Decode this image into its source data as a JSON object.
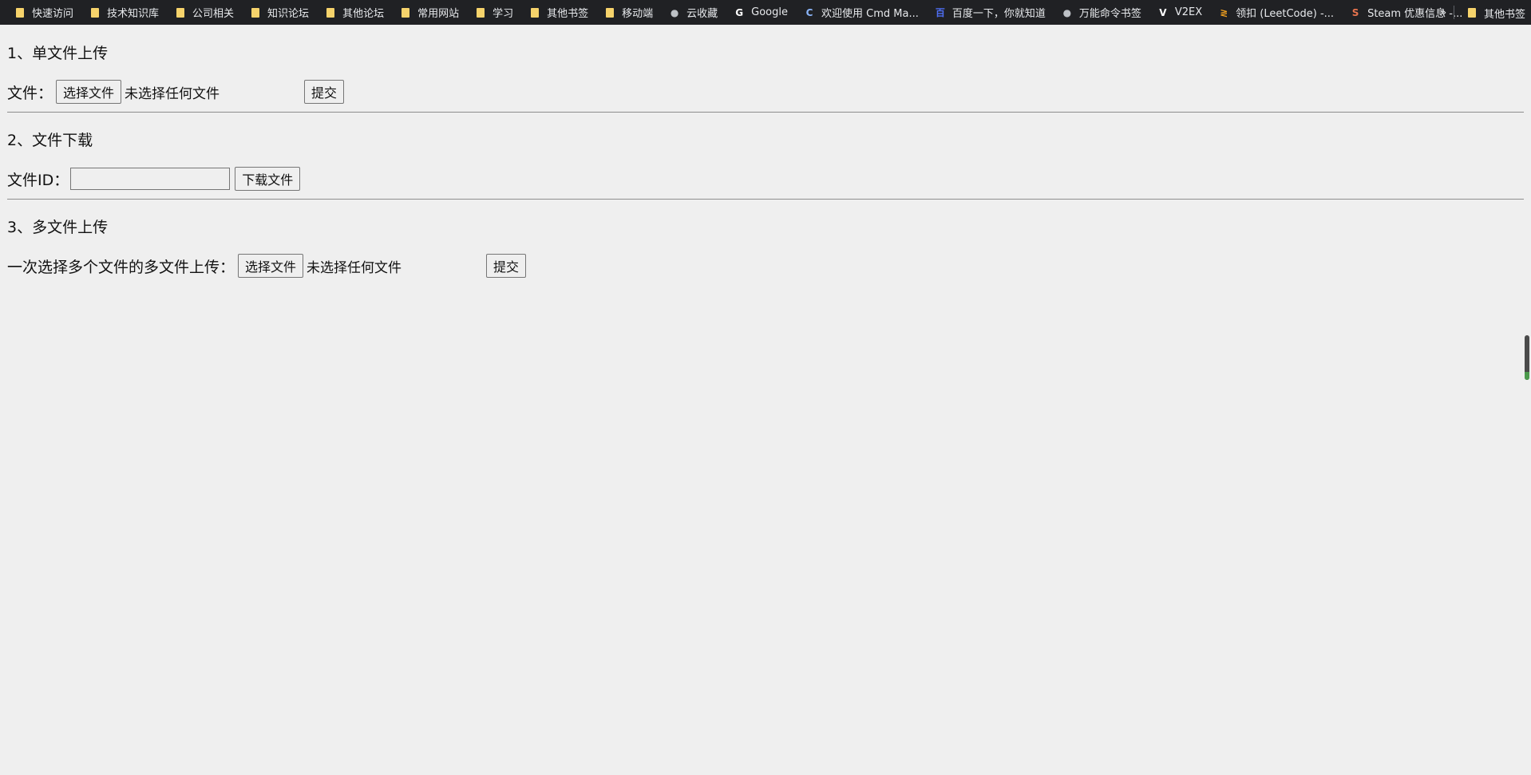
{
  "bookmarks": {
    "items": [
      {
        "label": "快速访问",
        "icon": "folder-icon"
      },
      {
        "label": "技术知识库",
        "icon": "folder-icon"
      },
      {
        "label": "公司相关",
        "icon": "folder-icon"
      },
      {
        "label": "知识论坛",
        "icon": "folder-icon"
      },
      {
        "label": "其他论坛",
        "icon": "folder-icon"
      },
      {
        "label": "常用网站",
        "icon": "folder-icon"
      },
      {
        "label": "学习",
        "icon": "folder-icon"
      },
      {
        "label": "其他书签",
        "icon": "folder-icon"
      },
      {
        "label": "移动端",
        "icon": "folder-icon"
      },
      {
        "label": "云收藏",
        "icon": "globe-icon"
      },
      {
        "label": "Google",
        "icon": "google-icon"
      },
      {
        "label": "欢迎使用 Cmd Ma...",
        "icon": "cmd-markdown-icon"
      },
      {
        "label": "百度一下，你就知道",
        "icon": "baidu-icon"
      },
      {
        "label": "万能命令书签",
        "icon": "globe-icon"
      },
      {
        "label": "V2EX",
        "icon": "v2ex-icon"
      },
      {
        "label": "领扣 (LeetCode) -...",
        "icon": "leetcode-icon"
      },
      {
        "label": "Steam 优惠信息 -...",
        "icon": "steam-icon"
      }
    ],
    "more_label": "»",
    "other_label": "其他书签"
  },
  "sections": {
    "single_upload": {
      "title": "1、单文件上传",
      "label": "文件：",
      "choose_button": "选择文件",
      "no_file_text": "未选择任何文件",
      "submit_button": "提交"
    },
    "download": {
      "title": "2、文件下载",
      "label": "文件ID：",
      "input_value": "",
      "download_button": "下载文件"
    },
    "multi_upload": {
      "title": "3、多文件上传",
      "label": "一次选择多个文件的多文件上传：",
      "choose_button": "选择文件",
      "no_file_text": "未选择任何文件",
      "submit_button": "提交"
    }
  },
  "colors": {
    "bookmarks_bg": "#202124",
    "page_bg": "#efefef",
    "folder": "#f6d36b"
  }
}
